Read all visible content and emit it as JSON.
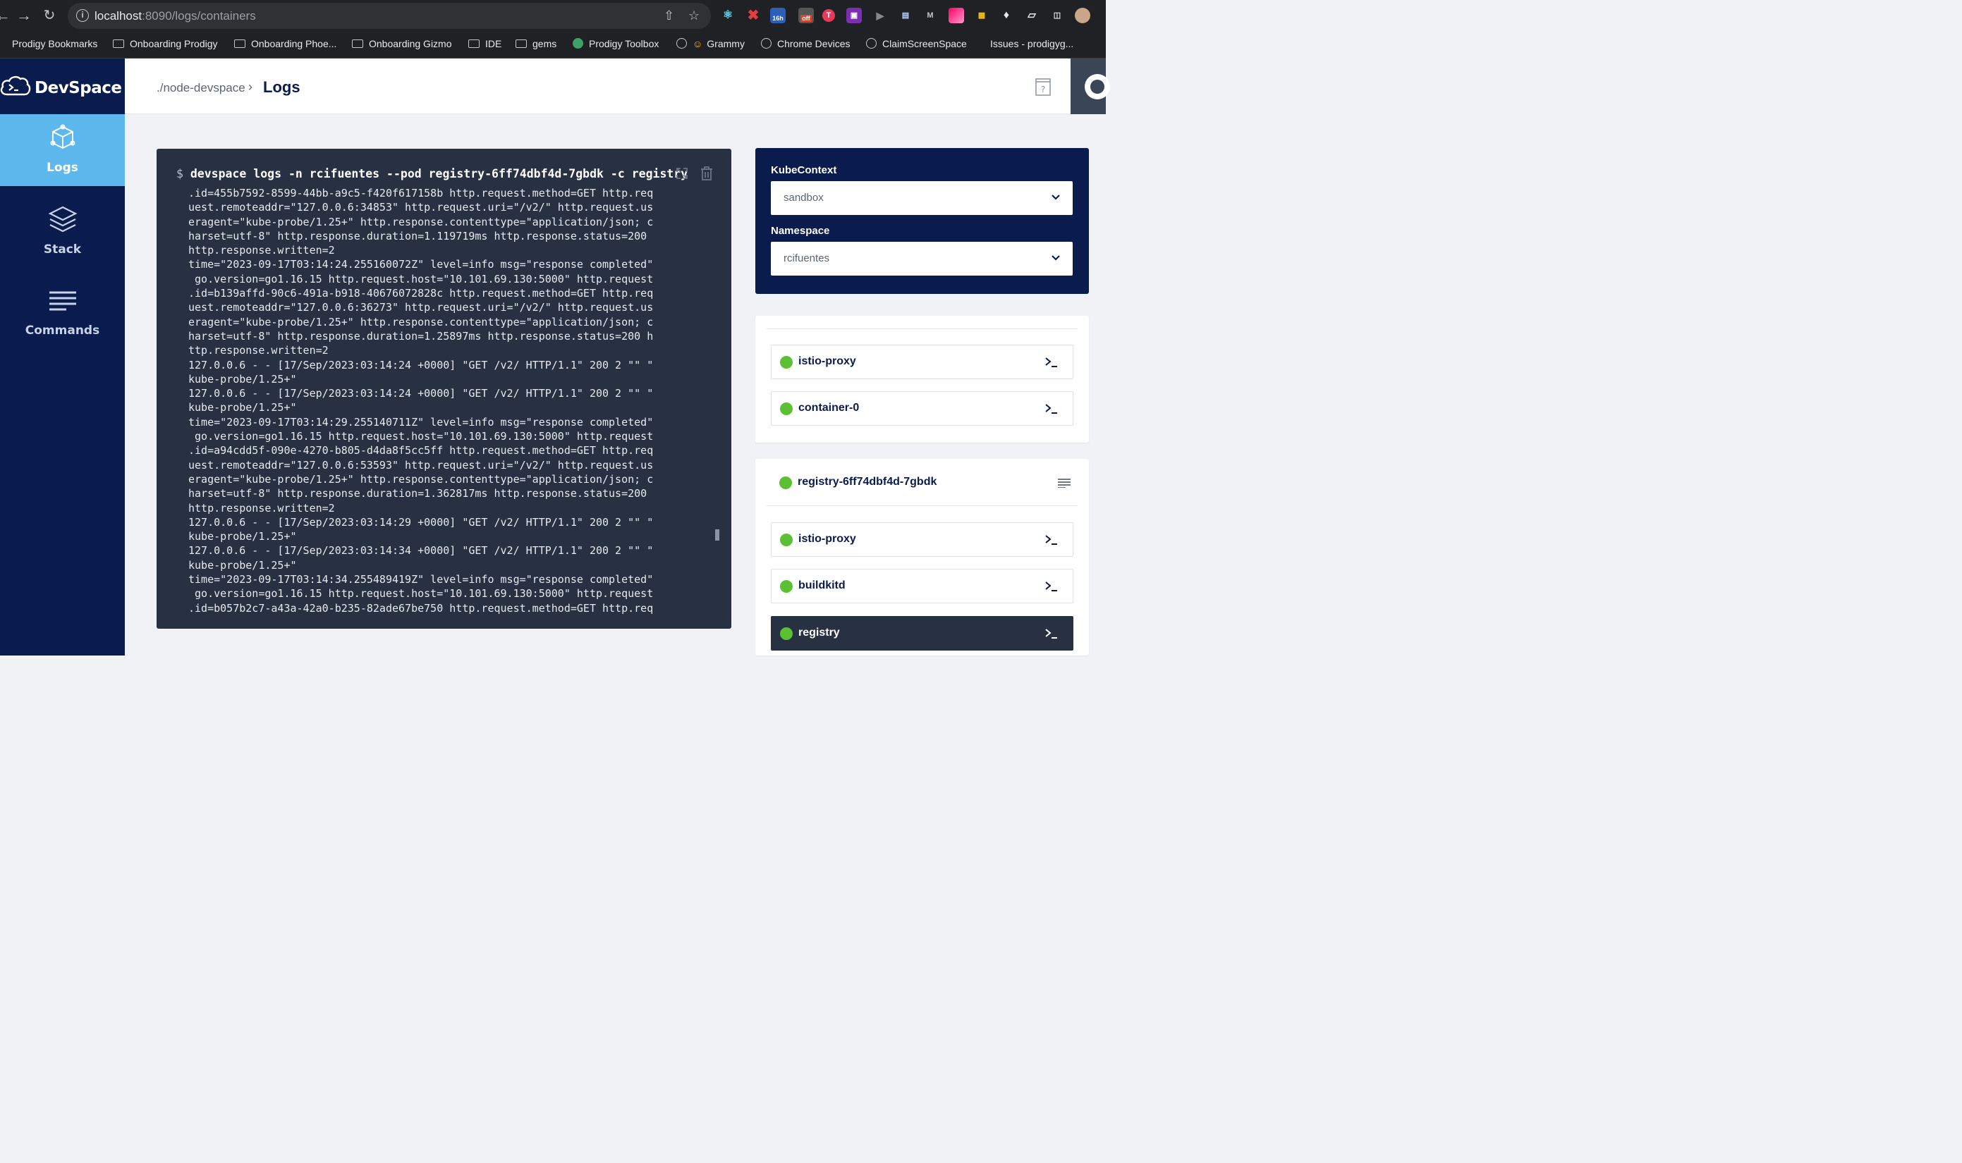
{
  "browser": {
    "url_host": "localhost",
    "url_rest": ":8090/logs/containers",
    "ext_badge_16h": "16h",
    "ext_badge_off": "off",
    "bookmarks": [
      {
        "label": "Prodigy Bookmarks",
        "icon": "none"
      },
      {
        "label": "Onboarding Prodigy",
        "icon": "folder-icon"
      },
      {
        "label": "Onboarding Phoe...",
        "icon": "folder-icon"
      },
      {
        "label": "Onboarding Gizmo",
        "icon": "folder-icon"
      },
      {
        "label": "IDE",
        "icon": "folder-icon"
      },
      {
        "label": "gems",
        "icon": "folder-icon"
      },
      {
        "label": "Prodigy Toolbox",
        "icon": "toolbox-icon"
      },
      {
        "label": "Grammy",
        "icon": "globe-icon"
      },
      {
        "label": "Chrome Devices",
        "icon": "globe-icon"
      },
      {
        "label": "ClaimScreenSpace",
        "icon": "globe-icon"
      },
      {
        "label": "Issues - prodigyg...",
        "icon": "github-icon"
      }
    ]
  },
  "app": {
    "brand": "DevSpace",
    "nav": [
      {
        "label": "Logs",
        "icon": "cube-icon",
        "active": true
      },
      {
        "label": "Stack",
        "icon": "layers-icon",
        "active": false
      },
      {
        "label": "Commands",
        "icon": "lines-icon",
        "active": false
      }
    ],
    "breadcrumb": "./node-devspace",
    "page_title": "Logs"
  },
  "terminal": {
    "prompt": "$",
    "command": "devspace logs -n rcifuentes --pod registry-6ff74dbf4d-7gbdk -c registry",
    "lines": [
      ".id=455b7592-8599-44bb-a9c5-f420f617158b http.request.method=GET http.req",
      "uest.remoteaddr=\"127.0.0.6:34853\" http.request.uri=\"/v2/\" http.request.us",
      "eragent=\"kube-probe/1.25+\" http.response.contenttype=\"application/json; c",
      "harset=utf-8\" http.response.duration=1.119719ms http.response.status=200",
      "http.response.written=2",
      "time=\"2023-09-17T03:14:24.255160072Z\" level=info msg=\"response completed\"",
      " go.version=go1.16.15 http.request.host=\"10.101.69.130:5000\" http.request",
      ".id=b139affd-90c6-491a-b918-40676072828c http.request.method=GET http.req",
      "uest.remoteaddr=\"127.0.0.6:36273\" http.request.uri=\"/v2/\" http.request.us",
      "eragent=\"kube-probe/1.25+\" http.response.contenttype=\"application/json; c",
      "harset=utf-8\" http.response.duration=1.25897ms http.response.status=200 h",
      "ttp.response.written=2",
      "127.0.0.6 - - [17/Sep/2023:03:14:24 +0000] \"GET /v2/ HTTP/1.1\" 200 2 \"\" \"",
      "kube-probe/1.25+\"",
      "127.0.0.6 - - [17/Sep/2023:03:14:24 +0000] \"GET /v2/ HTTP/1.1\" 200 2 \"\" \"",
      "kube-probe/1.25+\"",
      "time=\"2023-09-17T03:14:29.255140711Z\" level=info msg=\"response completed\"",
      " go.version=go1.16.15 http.request.host=\"10.101.69.130:5000\" http.request",
      ".id=a94cdd5f-090e-4270-b805-d4da8f5cc5ff http.request.method=GET http.req",
      "uest.remoteaddr=\"127.0.0.6:53593\" http.request.uri=\"/v2/\" http.request.us",
      "eragent=\"kube-probe/1.25+\" http.response.contenttype=\"application/json; c",
      "harset=utf-8\" http.response.duration=1.362817ms http.response.status=200",
      "http.response.written=2",
      "127.0.0.6 - - [17/Sep/2023:03:14:29 +0000] \"GET /v2/ HTTP/1.1\" 200 2 \"\" \"",
      "kube-probe/1.25+\"",
      "127.0.0.6 - - [17/Sep/2023:03:14:34 +0000] \"GET /v2/ HTTP/1.1\" 200 2 \"\" \"",
      "kube-probe/1.25+\"",
      "time=\"2023-09-17T03:14:34.255489419Z\" level=info msg=\"response completed\"",
      " go.version=go1.16.15 http.request.host=\"10.101.69.130:5000\" http.request",
      ".id=b057b2c7-a43a-42a0-b235-82ade67be750 http.request.method=GET http.req"
    ]
  },
  "context": {
    "kubecontext_label": "KubeContext",
    "kubecontext_value": "sandbox",
    "namespace_label": "Namespace",
    "namespace_value": "rcifuentes"
  },
  "pods": {
    "first_containers": [
      {
        "name": "istio-proxy",
        "status_color": "#5cc034"
      },
      {
        "name": "container-0",
        "status_color": "#5cc034"
      }
    ],
    "second_pod_name": "registry-6ff74dbf4d-7gbdk",
    "second_containers": [
      {
        "name": "istio-proxy",
        "selected": false
      },
      {
        "name": "buildkitd",
        "selected": false
      },
      {
        "name": "registry",
        "selected": true
      }
    ]
  },
  "colors": {
    "sidebar": "#0a1b4d",
    "accent": "#5cb8ed",
    "terminal": "#273142",
    "status_ok": "#5cc034"
  }
}
